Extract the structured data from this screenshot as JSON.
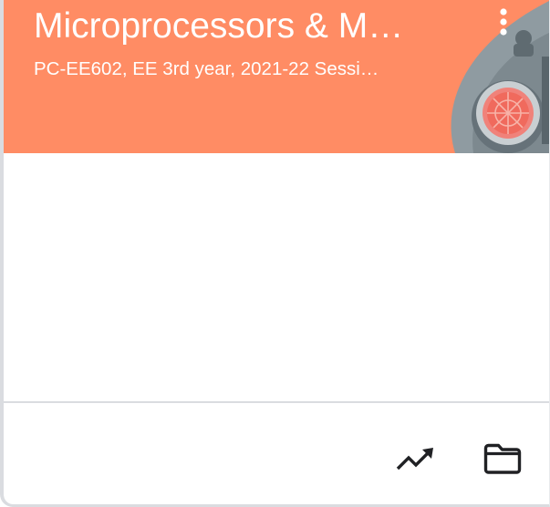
{
  "class_card": {
    "title": "Microprocessors & M…",
    "subtitle": "PC-EE602, EE 3rd year, 2021-22 Sessi…",
    "header_color": "#ff8c64",
    "actions": {
      "more_options_icon": "more-vert-icon",
      "progress_icon": "trending-up-icon",
      "folder_icon": "folder-icon"
    }
  }
}
